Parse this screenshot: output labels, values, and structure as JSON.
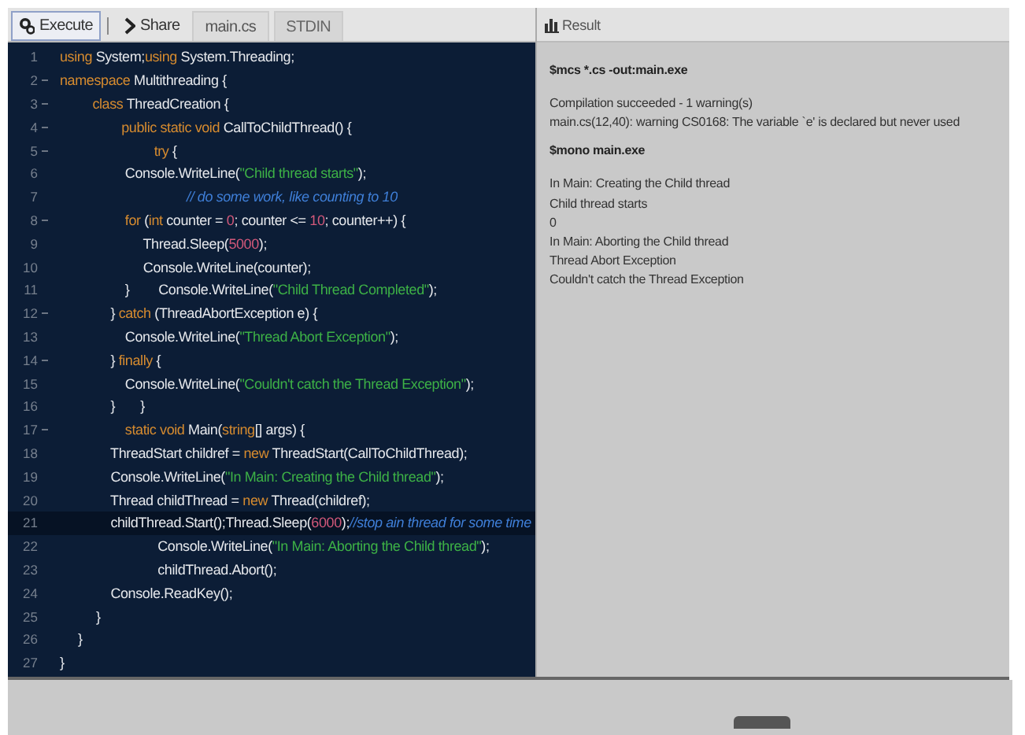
{
  "toolbar": {
    "buttons": [
      {
        "kind": "execute",
        "label": "Execute",
        "selected": true
      },
      {
        "kind": "share",
        "label": "Share",
        "selected": false
      }
    ],
    "tabs": [
      {
        "label": "main.cs",
        "selected": true
      },
      {
        "label": "STDIN",
        "selected": false
      }
    ]
  },
  "editor": {
    "lines": [
      {
        "number": "1",
        "fold": false,
        "active": false,
        "tokens": [
          {
            "kind": "kw",
            "text": "using"
          },
          {
            "kind": "plain",
            "text": " System;"
          },
          {
            "kind": "kw",
            "text": "using"
          },
          {
            "kind": "plain",
            "text": " System.Threading;"
          }
        ]
      },
      {
        "number": "2",
        "fold": true,
        "active": false,
        "tokens": [
          {
            "kind": "kw",
            "text": "namespace"
          },
          {
            "kind": "plain",
            "text": " Multithreading {"
          }
        ]
      },
      {
        "number": "3",
        "fold": true,
        "active": false,
        "tokens": [
          {
            "kind": "kw",
            "text": "         class"
          },
          {
            "kind": "plain",
            "text": " ThreadCreation {"
          }
        ]
      },
      {
        "number": "4",
        "fold": true,
        "active": false,
        "tokens": [
          {
            "kind": "kw",
            "text": "                 public static void"
          },
          {
            "kind": "plain",
            "text": " CallToChildThread() {"
          }
        ]
      },
      {
        "number": "5",
        "fold": true,
        "active": false,
        "tokens": [
          {
            "kind": "kw",
            "text": "                          try"
          },
          {
            "kind": "plain",
            "text": " {"
          }
        ]
      },
      {
        "number": "6",
        "fold": false,
        "active": false,
        "tokens": [
          {
            "kind": "plain",
            "text": "                  Console.WriteLine("
          },
          {
            "kind": "str",
            "text": "\"Child thread starts\""
          },
          {
            "kind": "plain",
            "text": ");"
          }
        ]
      },
      {
        "number": "7",
        "fold": false,
        "active": false,
        "tokens": [
          {
            "kind": "cmt",
            "text": "                                   // do some work, like counting to 10"
          }
        ]
      },
      {
        "number": "8",
        "fold": true,
        "active": false,
        "tokens": [
          {
            "kind": "kw",
            "text": "                  for"
          },
          {
            "kind": "plain",
            "text": " ("
          },
          {
            "kind": "kw",
            "text": "int"
          },
          {
            "kind": "plain",
            "text": " counter = "
          },
          {
            "kind": "num",
            "text": "0"
          },
          {
            "kind": "plain",
            "text": "; counter <= "
          },
          {
            "kind": "num",
            "text": "10"
          },
          {
            "kind": "plain",
            "text": "; counter++) {"
          }
        ]
      },
      {
        "number": "9",
        "fold": false,
        "active": false,
        "tokens": [
          {
            "kind": "plain",
            "text": "                       Thread.Sleep("
          },
          {
            "kind": "num",
            "text": "5000"
          },
          {
            "kind": "plain",
            "text": ");"
          }
        ]
      },
      {
        "number": "10",
        "fold": false,
        "active": false,
        "tokens": [
          {
            "kind": "plain",
            "text": "                       Console.WriteLine(counter);"
          }
        ]
      },
      {
        "number": "11",
        "fold": false,
        "active": false,
        "tokens": [
          {
            "kind": "plain",
            "text": "                  }        Console.WriteLine("
          },
          {
            "kind": "str",
            "text": "\"Child Thread Completed\""
          },
          {
            "kind": "plain",
            "text": ");"
          }
        ]
      },
      {
        "number": "12",
        "fold": true,
        "active": false,
        "tokens": [
          {
            "kind": "plain",
            "text": "              } "
          },
          {
            "kind": "kw",
            "text": "catch"
          },
          {
            "kind": "plain",
            "text": " (ThreadAbortException e) {"
          }
        ]
      },
      {
        "number": "13",
        "fold": false,
        "active": false,
        "tokens": [
          {
            "kind": "plain",
            "text": "                  Console.WriteLine("
          },
          {
            "kind": "str",
            "text": "\"Thread Abort Exception\""
          },
          {
            "kind": "plain",
            "text": ");"
          }
        ]
      },
      {
        "number": "14",
        "fold": true,
        "active": false,
        "tokens": [
          {
            "kind": "plain",
            "text": "              } "
          },
          {
            "kind": "kw",
            "text": "finally"
          },
          {
            "kind": "plain",
            "text": " {"
          }
        ]
      },
      {
        "number": "15",
        "fold": false,
        "active": false,
        "tokens": [
          {
            "kind": "plain",
            "text": "                  Console.WriteLine("
          },
          {
            "kind": "str",
            "text": "\"Couldn't catch the Thread Exception\""
          },
          {
            "kind": "plain",
            "text": ");"
          }
        ]
      },
      {
        "number": "16",
        "fold": false,
        "active": false,
        "tokens": [
          {
            "kind": "plain",
            "text": "              }       }"
          }
        ]
      },
      {
        "number": "17",
        "fold": true,
        "active": false,
        "tokens": [
          {
            "kind": "kw",
            "text": "                  static void"
          },
          {
            "kind": "plain",
            "text": " Main("
          },
          {
            "kind": "kw",
            "text": "string"
          },
          {
            "kind": "plain",
            "text": "[] args) {"
          }
        ]
      },
      {
        "number": "18",
        "fold": false,
        "active": false,
        "tokens": [
          {
            "kind": "plain",
            "text": "              ThreadStart childref = "
          },
          {
            "kind": "kw",
            "text": "new"
          },
          {
            "kind": "plain",
            "text": " ThreadStart(CallToChildThread);"
          }
        ]
      },
      {
        "number": "19",
        "fold": false,
        "active": false,
        "tokens": [
          {
            "kind": "plain",
            "text": "              Console.WriteLine("
          },
          {
            "kind": "str",
            "text": "\"In Main: Creating the Child thread\""
          },
          {
            "kind": "plain",
            "text": ");"
          }
        ]
      },
      {
        "number": "20",
        "fold": false,
        "active": false,
        "tokens": [
          {
            "kind": "plain",
            "text": "              Thread childThread = "
          },
          {
            "kind": "kw",
            "text": "new"
          },
          {
            "kind": "plain",
            "text": " Thread(childref);"
          }
        ]
      },
      {
        "number": "21",
        "fold": false,
        "active": true,
        "tokens": [
          {
            "kind": "plain",
            "text": "              childThread.Start();Thread.Sleep("
          },
          {
            "kind": "num",
            "text": "6000"
          },
          {
            "kind": "plain",
            "text": ");"
          },
          {
            "kind": "cmt",
            "text": "//stop ain thread for some time"
          }
        ]
      },
      {
        "number": "22",
        "fold": false,
        "active": false,
        "tokens": [
          {
            "kind": "plain",
            "text": "                           Console.WriteLine("
          },
          {
            "kind": "str",
            "text": "\"In Main: Aborting the Child thread\""
          },
          {
            "kind": "plain",
            "text": ");"
          }
        ]
      },
      {
        "number": "23",
        "fold": false,
        "active": false,
        "tokens": [
          {
            "kind": "plain",
            "text": "                           childThread.Abort();"
          }
        ]
      },
      {
        "number": "24",
        "fold": false,
        "active": false,
        "tokens": [
          {
            "kind": "plain",
            "text": "              Console.ReadKey();"
          }
        ]
      },
      {
        "number": "25",
        "fold": false,
        "active": false,
        "tokens": [
          {
            "kind": "plain",
            "text": "          }"
          }
        ]
      },
      {
        "number": "26",
        "fold": false,
        "active": false,
        "tokens": [
          {
            "kind": "plain",
            "text": "     }"
          }
        ]
      },
      {
        "number": "27",
        "fold": false,
        "active": false,
        "tokens": [
          {
            "kind": "plain",
            "text": "}"
          }
        ]
      }
    ]
  },
  "result": {
    "title": "Result",
    "blocks": [
      {
        "kind": "command",
        "lines": [
          "$mcs *.cs -out:main.exe"
        ]
      },
      {
        "kind": "output",
        "lines": [
          "Compilation succeeded - 1 warning(s)",
          "main.cs(12,40): warning CS0168: The variable `e' is declared but never used"
        ]
      },
      {
        "kind": "command",
        "lines": [
          "$mono main.exe"
        ]
      },
      {
        "kind": "output",
        "lines": [
          "In Main: Creating the Child thread",
          "Child thread starts",
          "0",
          "In Main: Aborting the Child thread",
          "Thread Abort Exception",
          "Couldn't catch the Thread Exception"
        ]
      }
    ]
  }
}
